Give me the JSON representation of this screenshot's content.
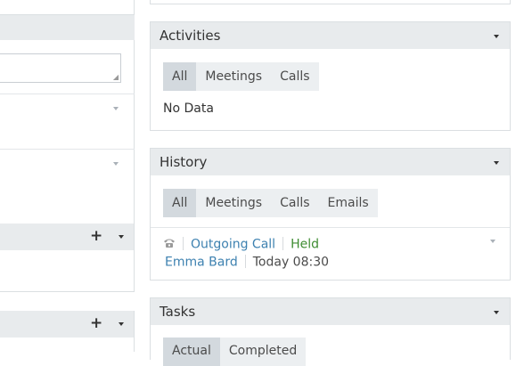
{
  "activities": {
    "title": "Activities",
    "tabs": [
      "All",
      "Meetings",
      "Calls"
    ],
    "active_tab": "All",
    "empty_text": "No Data"
  },
  "history": {
    "title": "History",
    "tabs": [
      "All",
      "Meetings",
      "Calls",
      "Emails"
    ],
    "active_tab": "All",
    "items": [
      {
        "icon": "phone-icon",
        "name": "Outgoing Call",
        "status": "Held",
        "contact": "Emma Bard",
        "time": "Today 08:30"
      }
    ]
  },
  "tasks": {
    "title": "Tasks",
    "tabs": [
      "Actual",
      "Completed"
    ],
    "active_tab": "Actual"
  },
  "left_panels": {
    "plus_symbol": "+"
  },
  "colors": {
    "header_bg": "#e8ebed",
    "active_tab_bg": "#d3d9de",
    "link": "#3d81b0",
    "held_status": "#3e8c32"
  }
}
